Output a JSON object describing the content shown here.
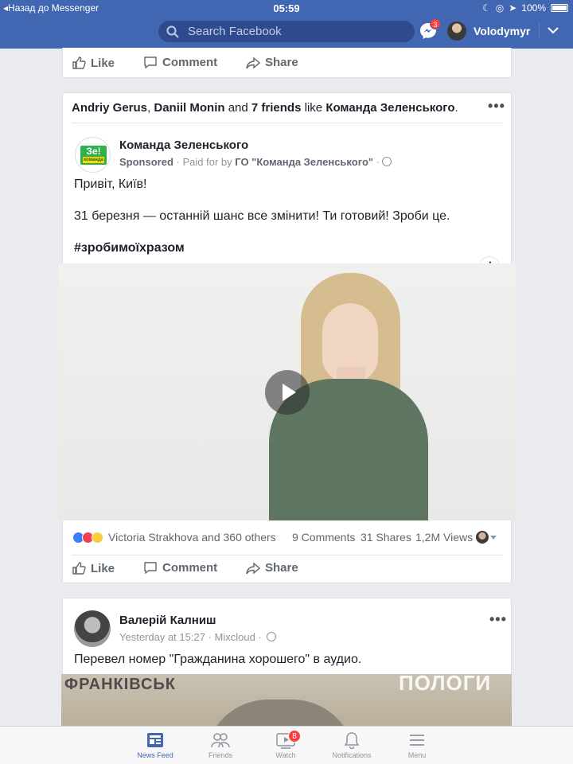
{
  "status_bar": {
    "back_label": "◂Назад до Messenger",
    "time": "05:59",
    "battery": "100%"
  },
  "header": {
    "search_placeholder": "Search Facebook",
    "messenger_badge": "3",
    "username": "Volodymyr"
  },
  "prev_post": {
    "like": "Like",
    "comment": "Comment",
    "share": "Share"
  },
  "sponsored_post": {
    "social_context": {
      "name1": "Andriy Gerus",
      "name2": "Daniil Monin",
      "and": "and",
      "friends": "7 friends",
      "like": "like",
      "page": "Команда Зеленського",
      "end": "."
    },
    "page_name": "Команда Зеленського",
    "logo_text": "Зе!",
    "logo_sub": "команда",
    "sponsored_label": "Sponsored",
    "paid_for": "· Paid for by",
    "payer": "ГО \"Команда Зеленського\"",
    "dot": "·",
    "text_line1": "Привіт, Київ!",
    "text_line2": "31 березня — останній шанс все змінити! Ти готовий! Зроби це.",
    "hashtag": "#зробимоїхразом",
    "reactions_text": "Victoria Strakhova and 360 others",
    "comments": "9 Comments",
    "shares": "31 Shares",
    "views": "1,2M Views",
    "like": "Like",
    "comment": "Comment",
    "share": "Share"
  },
  "next_post": {
    "author": "Валерій Калниш",
    "time": "Yesterday at 15:27",
    "source": "· Mixcloud ·",
    "text": "Перевел номер \"Гражданина хорошего\" в аудио.",
    "photo_text_left": "ФРАНКІВСЬК",
    "photo_text_right": "ПОЛОГИ"
  },
  "tabbar": {
    "news_feed": "News Feed",
    "friends": "Friends",
    "watch": "Watch",
    "watch_badge": "8",
    "notifications": "Notifications",
    "menu": "Menu"
  },
  "colors": {
    "brand": "#4267b2",
    "badge": "#fa3e3e"
  }
}
